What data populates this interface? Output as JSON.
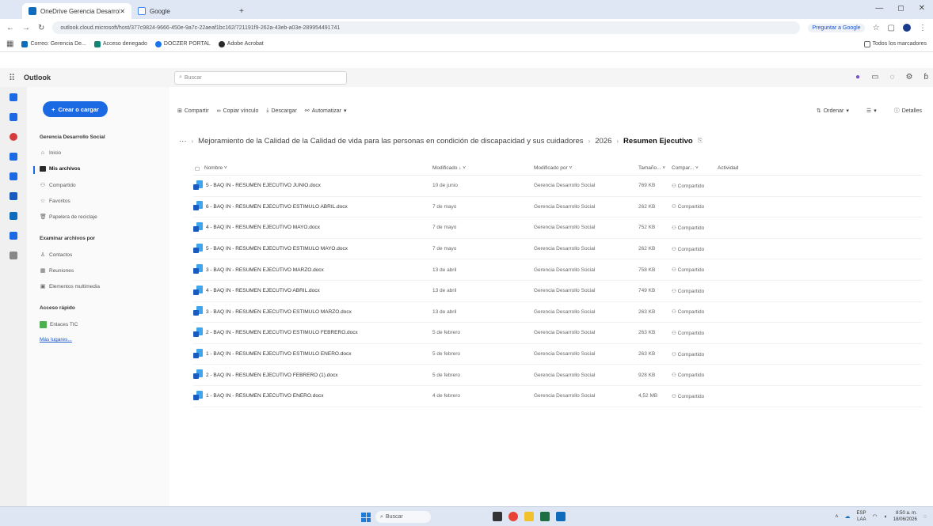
{
  "browser": {
    "tabs": [
      {
        "label": "OneDrive Gerencia Desarrollo",
        "active": true
      },
      {
        "label": "Google",
        "active": false
      }
    ],
    "url": "outlook.cloud.microsoft/host/377c9824-9666-450e-9a7c-22aeaf1bc162/721191f9-262a-43eb-a03e-289954491741",
    "ask_google": "Preguntar a Google",
    "bookmarks": [
      "Correo: Gerencia De...",
      "Acceso denegado",
      "DOCZER PORTAL",
      "Adobe Acrobat"
    ],
    "all_bookmarks": "Todos los marcadores"
  },
  "outlook": {
    "app_name": "Outlook",
    "search_placeholder": "Buscar"
  },
  "sidebar": {
    "create_label": "Crear o cargar",
    "account": "Gerencia Desarrollo Social",
    "items": [
      {
        "label": "Inicio",
        "icon": "home-icon"
      },
      {
        "label": "Mis archivos",
        "icon": "folder-icon",
        "active": true
      },
      {
        "label": "Compartido",
        "icon": "people-icon"
      },
      {
        "label": "Favoritos",
        "icon": "star-icon"
      },
      {
        "label": "Papelera de reciclaje",
        "icon": "trash-icon"
      }
    ],
    "browse_heading": "Examinar archivos por",
    "browse_items": [
      {
        "label": "Contactos",
        "icon": "person-icon"
      },
      {
        "label": "Reuniones",
        "icon": "calendar-icon"
      },
      {
        "label": "Elementos multimedia",
        "icon": "image-icon"
      }
    ],
    "quick_heading": "Acceso rápido",
    "quick_items": [
      {
        "label": "Enlaces TIC",
        "icon": "site-icon"
      }
    ],
    "more_link": "Más lugares..."
  },
  "toolbar": {
    "share": "Compartir",
    "copy_link": "Copiar vínculo",
    "download": "Descargar",
    "automate": "Automatizar",
    "sort": "Ordenar",
    "details": "Detalles"
  },
  "breadcrumb": {
    "folder": "Mejoramiento de la Calidad de la Calidad de vida para las personas en condición de discapacidad y sus cuidadores",
    "year": "2026",
    "current": "Resumen Ejecutivo"
  },
  "table": {
    "headers": {
      "name": "Nombre",
      "modified": "Modificado",
      "modified_by": "Modificado por",
      "size": "Tamaño...",
      "sharing": "Compar...",
      "activity": "Actividad"
    },
    "rows": [
      {
        "name": "5 - BAQ IN - RESUMEN EJECUTIVO JUNIO.docx",
        "modified": "10 de junio",
        "by": "Gerencia Desarrollo Social",
        "size": "769 KB",
        "sharing": "Compartido"
      },
      {
        "name": "6 - BAQ IN - RESUMEN EJECUTIVO ESTIMULO ABRIL.docx",
        "modified": "7 de mayo",
        "by": "Gerencia Desarrollo Social",
        "size": "262 KB",
        "sharing": "Compartido"
      },
      {
        "name": "4 - BAQ IN - RESUMEN EJECUTIVO MAYO.docx",
        "modified": "7 de mayo",
        "by": "Gerencia Desarrollo Social",
        "size": "752 KB",
        "sharing": "Compartido"
      },
      {
        "name": "5 - BAQ IN - RESUMEN EJECUTIVO ESTIMULO MAYO.docx",
        "modified": "7 de mayo",
        "by": "Gerencia Desarrollo Social",
        "size": "262 KB",
        "sharing": "Compartido"
      },
      {
        "name": "3 - BAQ IN - RESUMEN EJECUTIVO MARZO.docx",
        "modified": "13 de abril",
        "by": "Gerencia Desarrollo Social",
        "size": "758 KB",
        "sharing": "Compartido"
      },
      {
        "name": "4 - BAQ IN - RESUMEN EJECUTIVO ABRIL.docx",
        "modified": "13 de abril",
        "by": "Gerencia Desarrollo Social",
        "size": "749 KB",
        "sharing": "Compartido"
      },
      {
        "name": "3 - BAQ IN - RESUMEN EJECUTIVO ESTIMULO MARZO.docx",
        "modified": "13 de abril",
        "by": "Gerencia Desarrollo Social",
        "size": "263 KB",
        "sharing": "Compartido"
      },
      {
        "name": "2 - BAQ IN - RESUMEN EJECUTIVO ESTIMULO FEBRERO.docx",
        "modified": "5 de febrero",
        "by": "Gerencia Desarrollo Social",
        "size": "263 KB",
        "sharing": "Compartido"
      },
      {
        "name": "1 - BAQ IN - RESUMEN EJECUTIVO ESTIMULO ENERO.docx",
        "modified": "5 de febrero",
        "by": "Gerencia Desarrollo Social",
        "size": "263 KB",
        "sharing": "Compartido"
      },
      {
        "name": "2 - BAQ IN - RESUMEN EJECUTIVO FEBRERO (1).docx",
        "modified": "5 de febrero",
        "by": "Gerencia Desarrollo Social",
        "size": "928 KB",
        "sharing": "Compartido"
      },
      {
        "name": "1 - BAQ IN - RESUMEN EJECUTIVO ENERO.docx",
        "modified": "4 de febrero",
        "by": "Gerencia Desarrollo Social",
        "size": "4,52 MB",
        "sharing": "Compartido"
      }
    ]
  },
  "taskbar": {
    "search": "Buscar",
    "lang": "ESP",
    "lang2": "LAA",
    "time": "8:50 a. m.",
    "date": "18/06/2026"
  },
  "colors": {
    "accent": "#1b6ae3",
    "word_light": "#41a5ee",
    "word_dark": "#185abd"
  }
}
